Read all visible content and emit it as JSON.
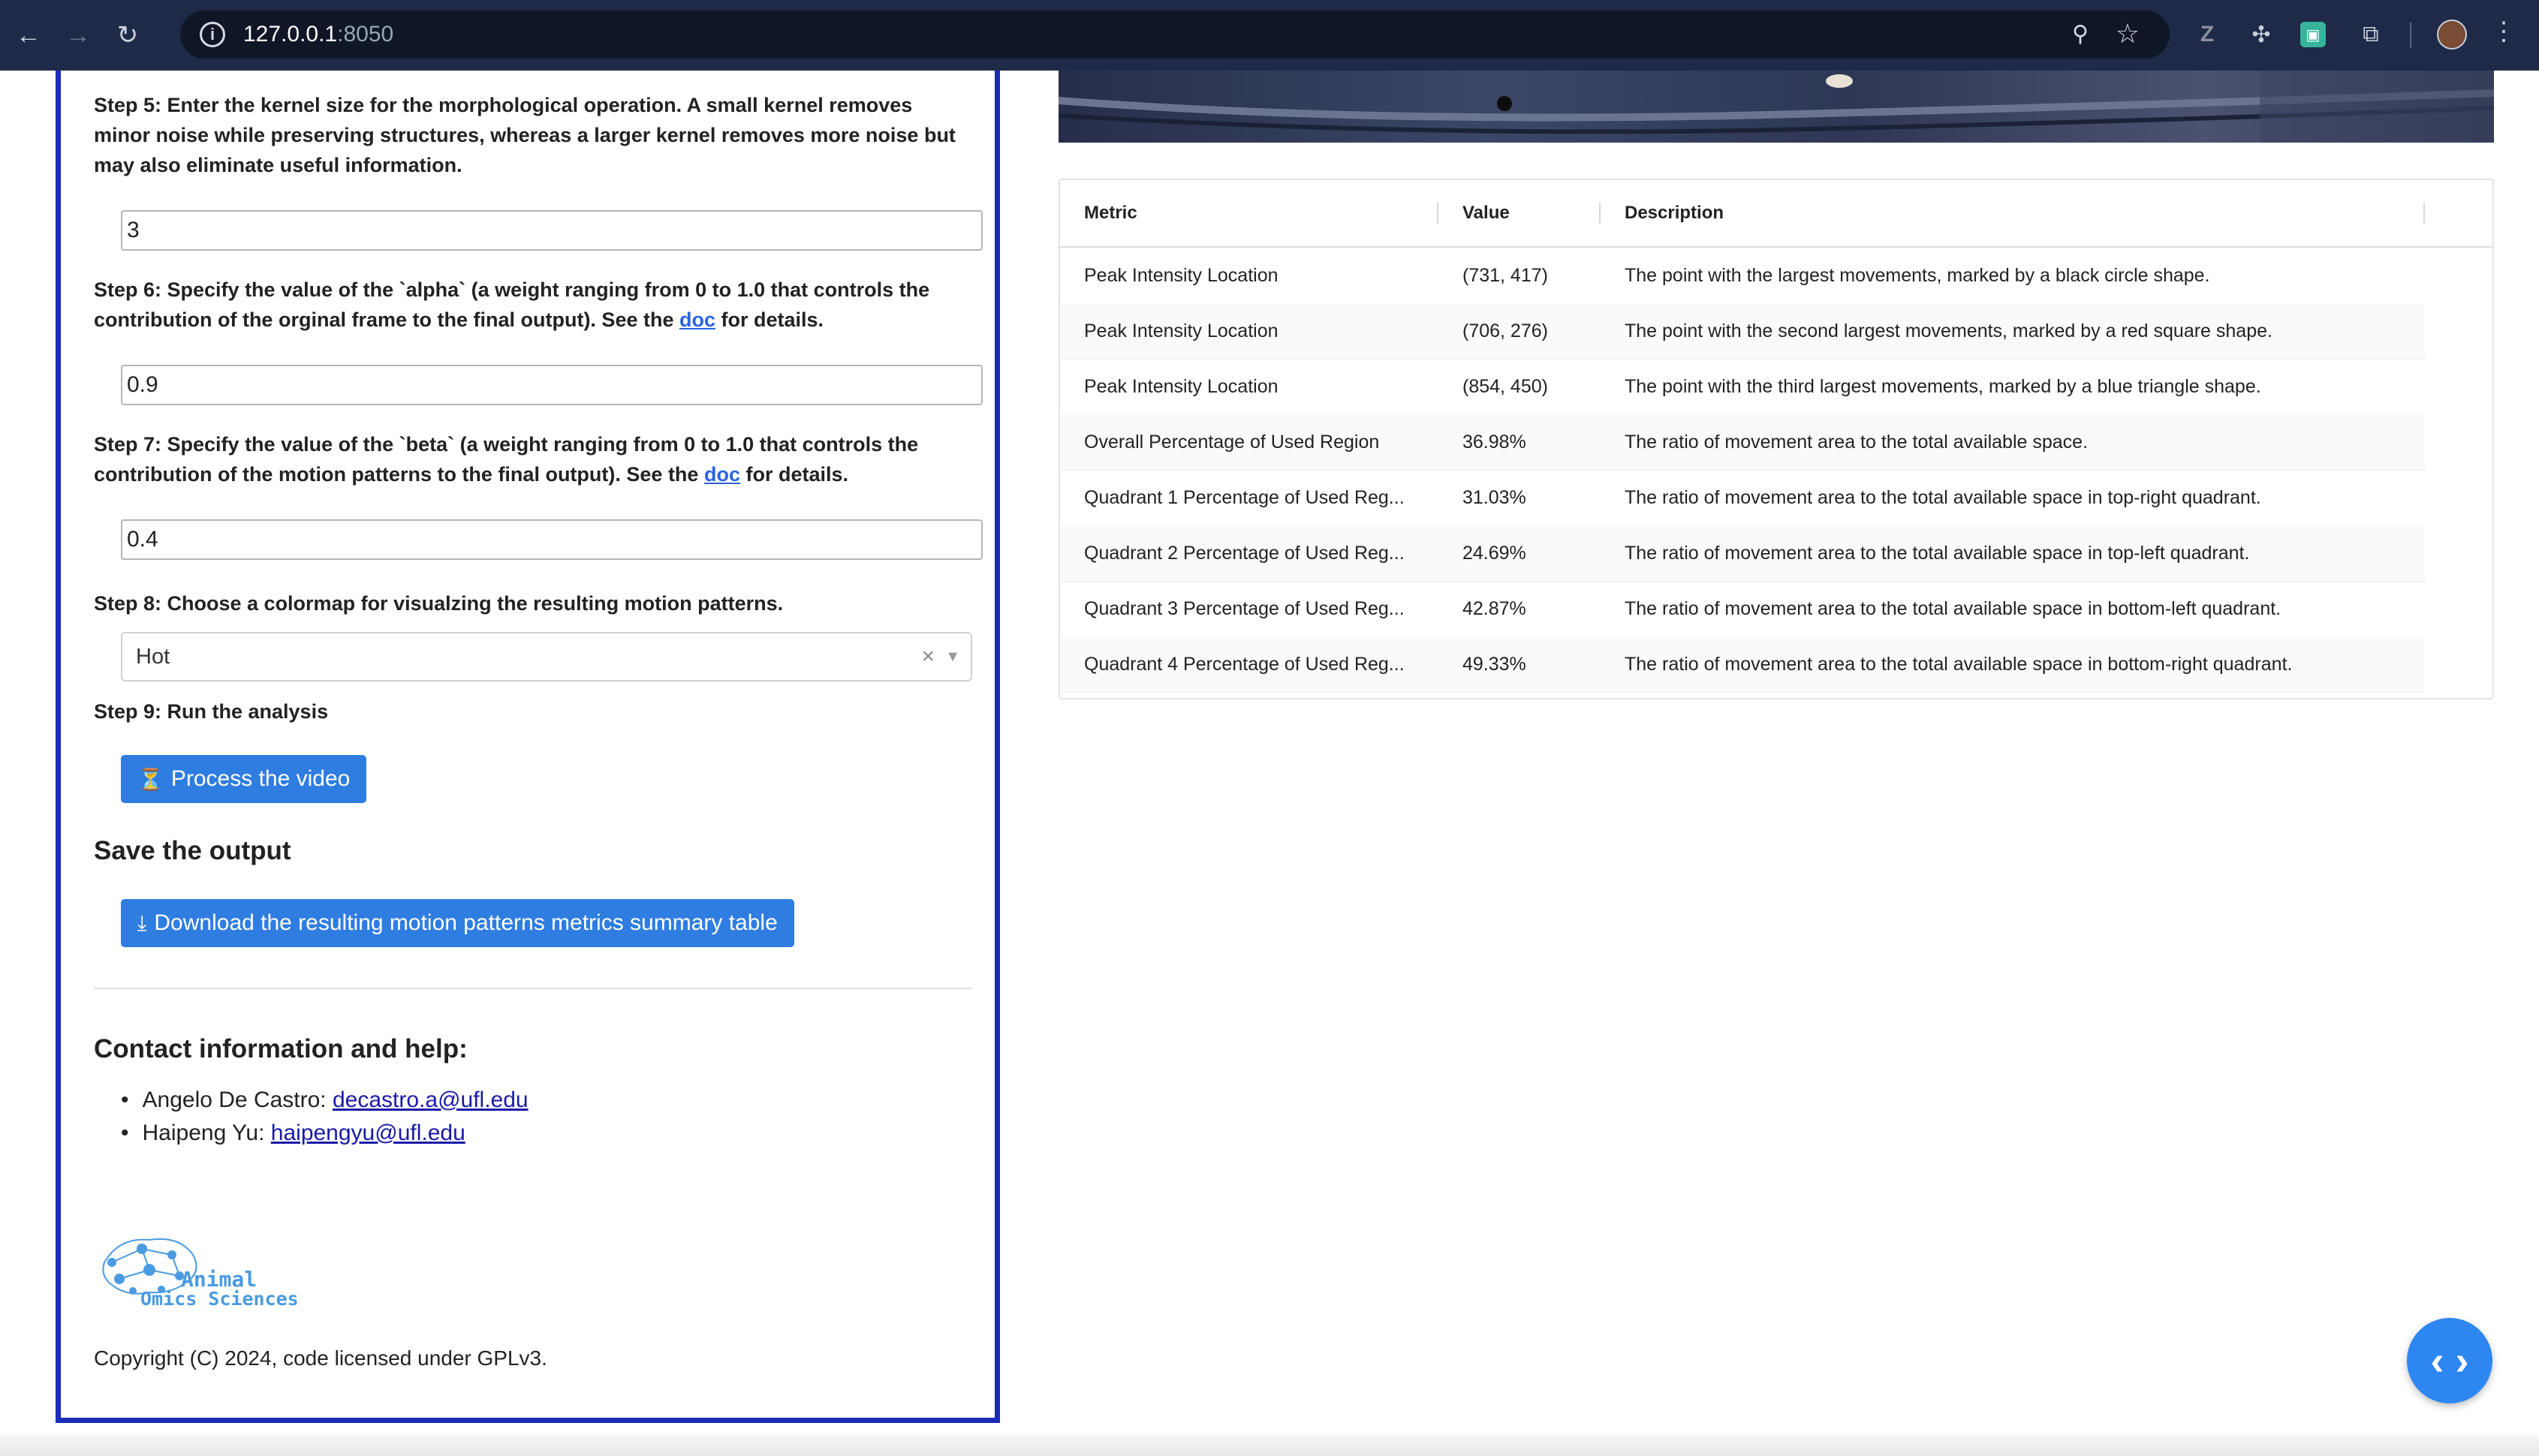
{
  "browser": {
    "url_host": "127.0.0.1",
    "url_port": ":8050"
  },
  "steps": {
    "step5": "Step 5: Enter the kernel size for the morphological operation. A small kernel removes minor noise while preserving structures, whereas a larger kernel removes more noise but may also eliminate useful information.",
    "kernel_value": "3",
    "step6_pre": "Step 6: Specify the value of the `alpha` (a weight ranging from 0 to 1.0 that controls the contribution of the orginal frame to the final output). See the ",
    "step6_link": "doc",
    "step6_post": " for details.",
    "alpha_value": "0.9",
    "step7_pre": "Step 7: Specify the value of the `beta` (a weight ranging from 0 to 1.0 that controls the contribution of the motion patterns to the final output). See the ",
    "step7_link": "doc",
    "step7_post": " for details.",
    "beta_value": "0.4",
    "step8": "Step 8: Choose a colormap for visualzing the resulting motion patterns.",
    "colormap_value": "Hot",
    "step9": "Step 9: Run the analysis",
    "process_button": "Process the video"
  },
  "save": {
    "heading": "Save the output",
    "download_button": "Download the resulting motion patterns metrics summary table"
  },
  "contact": {
    "heading": "Contact information and help:",
    "people": [
      {
        "name": "Angelo De Castro: ",
        "email": "decastro.a@ufl.edu"
      },
      {
        "name": "Haipeng Yu: ",
        "email": "haipengyu@ufl.edu"
      }
    ]
  },
  "logo": {
    "line1": "Animal",
    "line2": "Omics Sciences"
  },
  "footer": {
    "copyright": "Copyright (C) 2024, code licensed under GPLv3."
  },
  "table": {
    "headers": [
      "Metric",
      "Value",
      "Description"
    ],
    "rows": [
      {
        "metric": "Peak Intensity Location",
        "value": "(731, 417)",
        "description": "The point with the largest movements, marked by a black circle shape."
      },
      {
        "metric": "Peak Intensity Location",
        "value": "(706, 276)",
        "description": "The point with the second largest movements, marked by a red square shape."
      },
      {
        "metric": "Peak Intensity Location",
        "value": "(854, 450)",
        "description": "The point with the third largest movements, marked by a blue triangle shape."
      },
      {
        "metric": "Overall Percentage of Used Region",
        "value": "36.98%",
        "description": "The ratio of movement area to the total available space."
      },
      {
        "metric": "Quadrant 1 Percentage of Used Reg...",
        "value": "31.03%",
        "description": "The ratio of movement area to the total available space in top-right quadrant."
      },
      {
        "metric": "Quadrant 2 Percentage of Used Reg...",
        "value": "24.69%",
        "description": "The ratio of movement area to the total available space in top-left quadrant."
      },
      {
        "metric": "Quadrant 3 Percentage of Used Reg...",
        "value": "42.87%",
        "description": "The ratio of movement area to the total available space in bottom-left quadrant."
      },
      {
        "metric": "Quadrant 4 Percentage of Used Reg...",
        "value": "49.33%",
        "description": "The ratio of movement area to the total available space in bottom-right quadrant."
      }
    ]
  },
  "icons": {
    "hourglass": "hourglass-icon",
    "download": "download-icon",
    "code": "code-icon"
  }
}
